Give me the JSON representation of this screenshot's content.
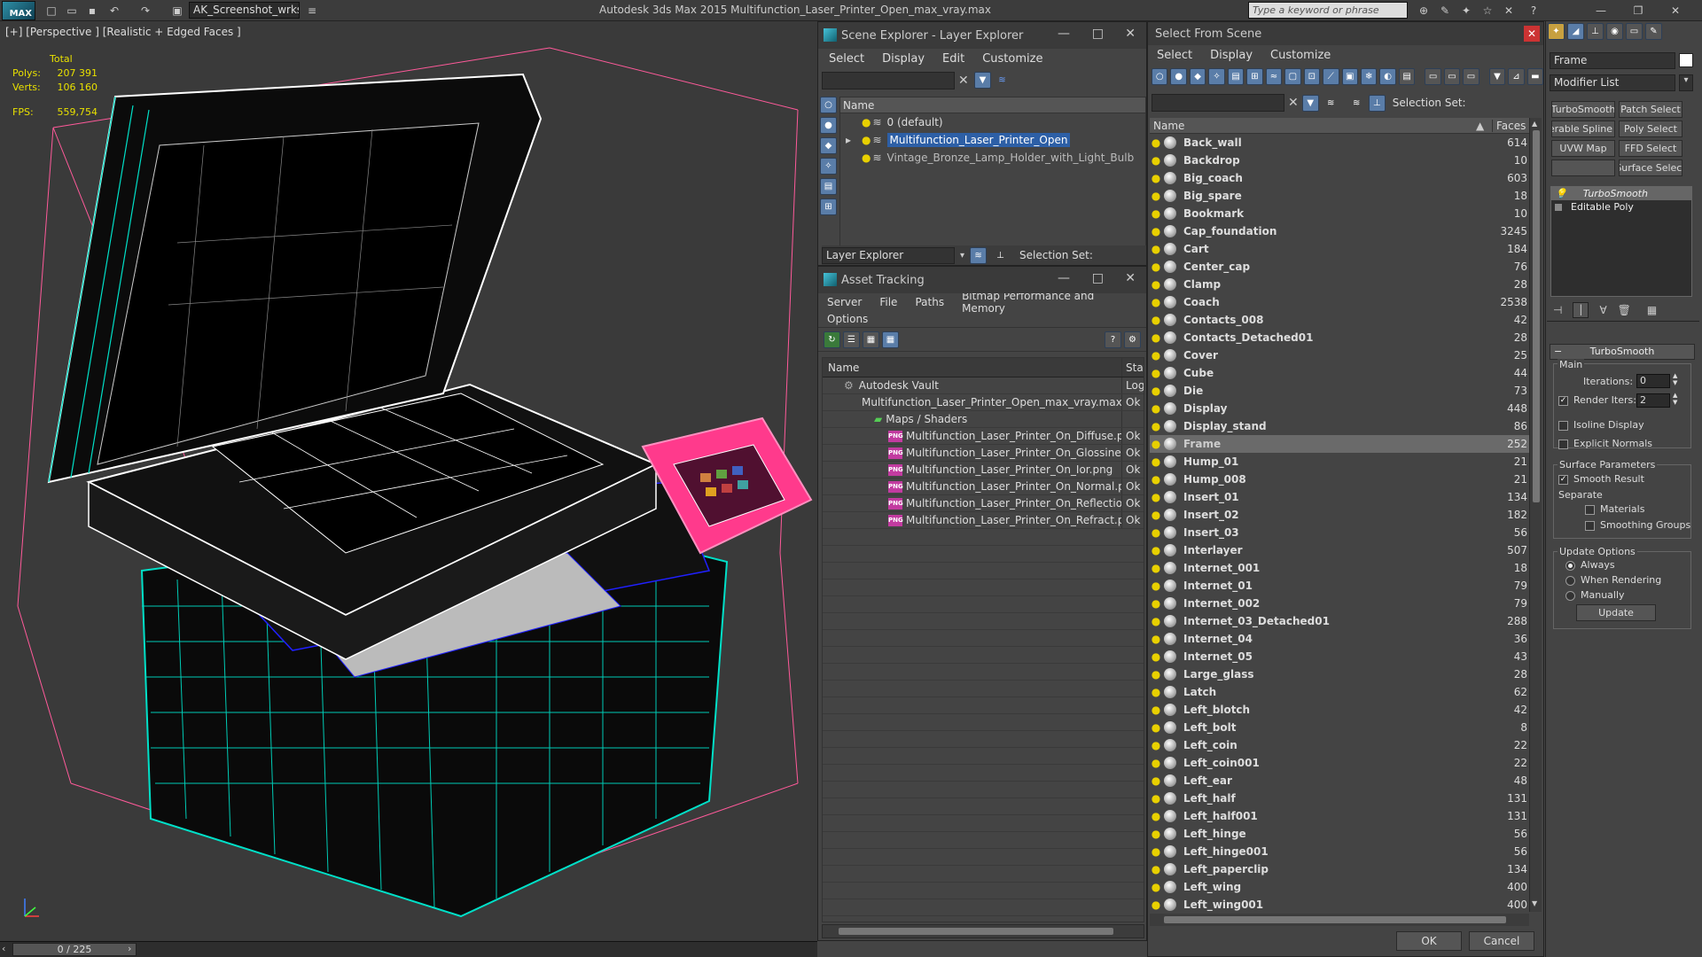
{
  "app": {
    "logo": "MAX",
    "title": "Autodesk 3ds Max  2015    Multifunction_Laser_Printer_Open_max_vray.max",
    "workspace": "AK_Screenshot_wrksp",
    "search_placeholder": "Type a keyword or phrase"
  },
  "viewport": {
    "label": "[+] [Perspective ] [Realistic + Edged Faces ]",
    "stats": {
      "header": "Total",
      "polys_label": "Polys:",
      "polys_value": "207 391",
      "verts_label": "Verts:",
      "verts_value": "106 160",
      "fps_label": "FPS:",
      "fps_value": "559,754"
    },
    "timeline": "0 / 225"
  },
  "layer_explorer": {
    "title": "Scene Explorer - Layer Explorer",
    "menu": [
      "Select",
      "Display",
      "Edit",
      "Customize"
    ],
    "column_name": "Name",
    "layers": [
      {
        "name": "0 (default)",
        "selected": false
      },
      {
        "name": "Multifunction_Laser_Printer_Open",
        "selected": true
      },
      {
        "name": "Vintage_Bronze_Lamp_Holder_with_Light_Bulb",
        "selected": false
      }
    ],
    "footer_dropdown": "Layer Explorer",
    "selection_set_label": "Selection Set:"
  },
  "asset_tracking": {
    "title": "Asset Tracking",
    "menu": [
      "Server",
      "File",
      "Paths",
      "Bitmap Performance and Memory"
    ],
    "menu2": "Options",
    "col_name": "Name",
    "col_status": "Stat",
    "rows": [
      {
        "name": "Autodesk Vault",
        "status": "Log",
        "indent": 1,
        "type": "vault"
      },
      {
        "name": "Multifunction_Laser_Printer_Open_max_vray.max",
        "status": "Ok",
        "indent": 2,
        "type": "max"
      },
      {
        "name": "Maps / Shaders",
        "status": "",
        "indent": 3,
        "type": "folder"
      },
      {
        "name": "Multifunction_Laser_Printer_On_Diffuse.png",
        "status": "Ok",
        "indent": 4,
        "type": "png"
      },
      {
        "name": "Multifunction_Laser_Printer_On_Glossiness.png",
        "status": "Ok",
        "indent": 4,
        "type": "png"
      },
      {
        "name": "Multifunction_Laser_Printer_On_Ior.png",
        "status": "Ok",
        "indent": 4,
        "type": "png"
      },
      {
        "name": "Multifunction_Laser_Printer_On_Normal.png",
        "status": "Ok",
        "indent": 4,
        "type": "png"
      },
      {
        "name": "Multifunction_Laser_Printer_On_Reflection.png",
        "status": "Ok",
        "indent": 4,
        "type": "png"
      },
      {
        "name": "Multifunction_Laser_Printer_On_Refract.png",
        "status": "Ok",
        "indent": 4,
        "type": "png"
      }
    ],
    "png_badge": "PNG"
  },
  "select_from_scene": {
    "title": "Select From Scene",
    "menu": [
      "Select",
      "Display",
      "Customize"
    ],
    "selection_set_label": "Selection Set:",
    "col_name": "Name",
    "col_faces": "Faces",
    "objects": [
      {
        "name": "Back_wall",
        "faces": "614"
      },
      {
        "name": "Backdrop",
        "faces": "10"
      },
      {
        "name": "Big_coach",
        "faces": "603"
      },
      {
        "name": "Big_spare",
        "faces": "18"
      },
      {
        "name": "Bookmark",
        "faces": "10"
      },
      {
        "name": "Cap_foundation",
        "faces": "3245"
      },
      {
        "name": "Cart",
        "faces": "184"
      },
      {
        "name": "Center_cap",
        "faces": "76"
      },
      {
        "name": "Clamp",
        "faces": "28"
      },
      {
        "name": "Coach",
        "faces": "2538"
      },
      {
        "name": "Contacts_008",
        "faces": "42"
      },
      {
        "name": "Contacts_Detached01",
        "faces": "28"
      },
      {
        "name": "Cover",
        "faces": "25"
      },
      {
        "name": "Cube",
        "faces": "44"
      },
      {
        "name": "Die",
        "faces": "73"
      },
      {
        "name": "Display",
        "faces": "448"
      },
      {
        "name": "Display_stand",
        "faces": "86"
      },
      {
        "name": "Frame",
        "faces": "252",
        "selected": true
      },
      {
        "name": "Hump_01",
        "faces": "21"
      },
      {
        "name": "Hump_008",
        "faces": "21"
      },
      {
        "name": "Insert_01",
        "faces": "134"
      },
      {
        "name": "Insert_02",
        "faces": "182"
      },
      {
        "name": "Insert_03",
        "faces": "56"
      },
      {
        "name": "Interlayer",
        "faces": "507"
      },
      {
        "name": "Internet_001",
        "faces": "18"
      },
      {
        "name": "Internet_01",
        "faces": "79"
      },
      {
        "name": "Internet_002",
        "faces": "79"
      },
      {
        "name": "Internet_03_Detached01",
        "faces": "288"
      },
      {
        "name": "Internet_04",
        "faces": "36"
      },
      {
        "name": "Internet_05",
        "faces": "43"
      },
      {
        "name": "Large_glass",
        "faces": "28"
      },
      {
        "name": "Latch",
        "faces": "62"
      },
      {
        "name": "Left_blotch",
        "faces": "42"
      },
      {
        "name": "Left_bolt",
        "faces": "8"
      },
      {
        "name": "Left_coin",
        "faces": "22"
      },
      {
        "name": "Left_coin001",
        "faces": "22"
      },
      {
        "name": "Left_ear",
        "faces": "48"
      },
      {
        "name": "Left_half",
        "faces": "131"
      },
      {
        "name": "Left_half001",
        "faces": "131"
      },
      {
        "name": "Left_hinge",
        "faces": "56"
      },
      {
        "name": "Left_hinge001",
        "faces": "56"
      },
      {
        "name": "Left_paperclip",
        "faces": "134"
      },
      {
        "name": "Left_wing",
        "faces": "400"
      },
      {
        "name": "Left_wing001",
        "faces": "400"
      }
    ],
    "ok": "OK",
    "cancel": "Cancel"
  },
  "command_panel": {
    "object_name": "Frame",
    "modifier_list": "Modifier List",
    "buttons": [
      "TurboSmooth",
      "Patch Select",
      "Renderable Spline",
      "Poly Select",
      "UVW Map",
      "FFD Select",
      "",
      "Surface Select"
    ],
    "stack": [
      "TurboSmooth",
      "Editable Poly"
    ],
    "rollout_title": "TurboSmooth",
    "main_label": "Main",
    "iterations_label": "Iterations:",
    "iterations_value": "0",
    "render_iters_label": "Render Iters:",
    "render_iters_value": "2",
    "isoline_label": "Isoline Display",
    "explicit_normals_label": "Explicit Normals",
    "surface_params_label": "Surface Parameters",
    "smooth_result_label": "Smooth Result",
    "separate_label": "Separate",
    "materials_label": "Materials",
    "smoothing_groups_label": "Smoothing Groups",
    "update_options_label": "Update Options",
    "always_label": "Always",
    "when_rendering_label": "When Rendering",
    "manually_label": "Manually",
    "update_button": "Update"
  },
  "colors": {
    "selection_blue": "#2d5fa6",
    "wire_cyan": "#00e0c8",
    "wire_blue": "#2020ff",
    "wire_pink": "#ff3a8c",
    "stats_yellow": "#e8e000"
  }
}
